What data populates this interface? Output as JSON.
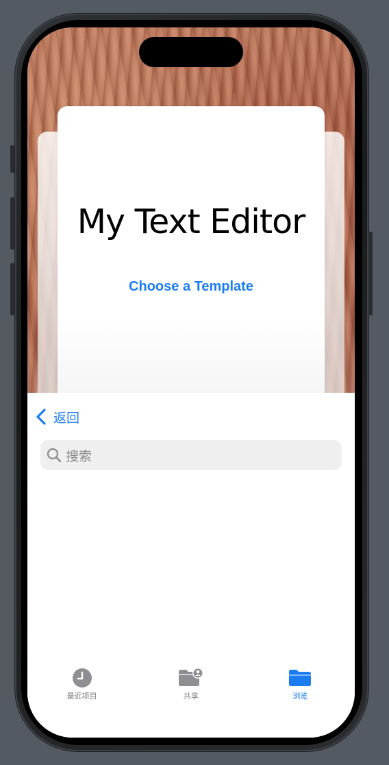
{
  "document_preview": {
    "title": "My Text Editor",
    "action_label": "Choose a Template"
  },
  "file_browser": {
    "back_label": "返回",
    "back_icon": "chevron-left-icon",
    "search": {
      "placeholder": "搜索",
      "icon": "magnifying-glass-icon"
    }
  },
  "tab_bar": {
    "tabs": [
      {
        "label": "最近项目",
        "icon": "clock-icon",
        "active": false
      },
      {
        "label": "共享",
        "icon": "shared-folder-icon",
        "active": false
      },
      {
        "label": "浏览",
        "icon": "folder-icon",
        "active": true
      }
    ]
  },
  "colors": {
    "accent": "#1a7cf0",
    "inactive_tab": "#7e7e82",
    "search_bg": "#efefef"
  }
}
